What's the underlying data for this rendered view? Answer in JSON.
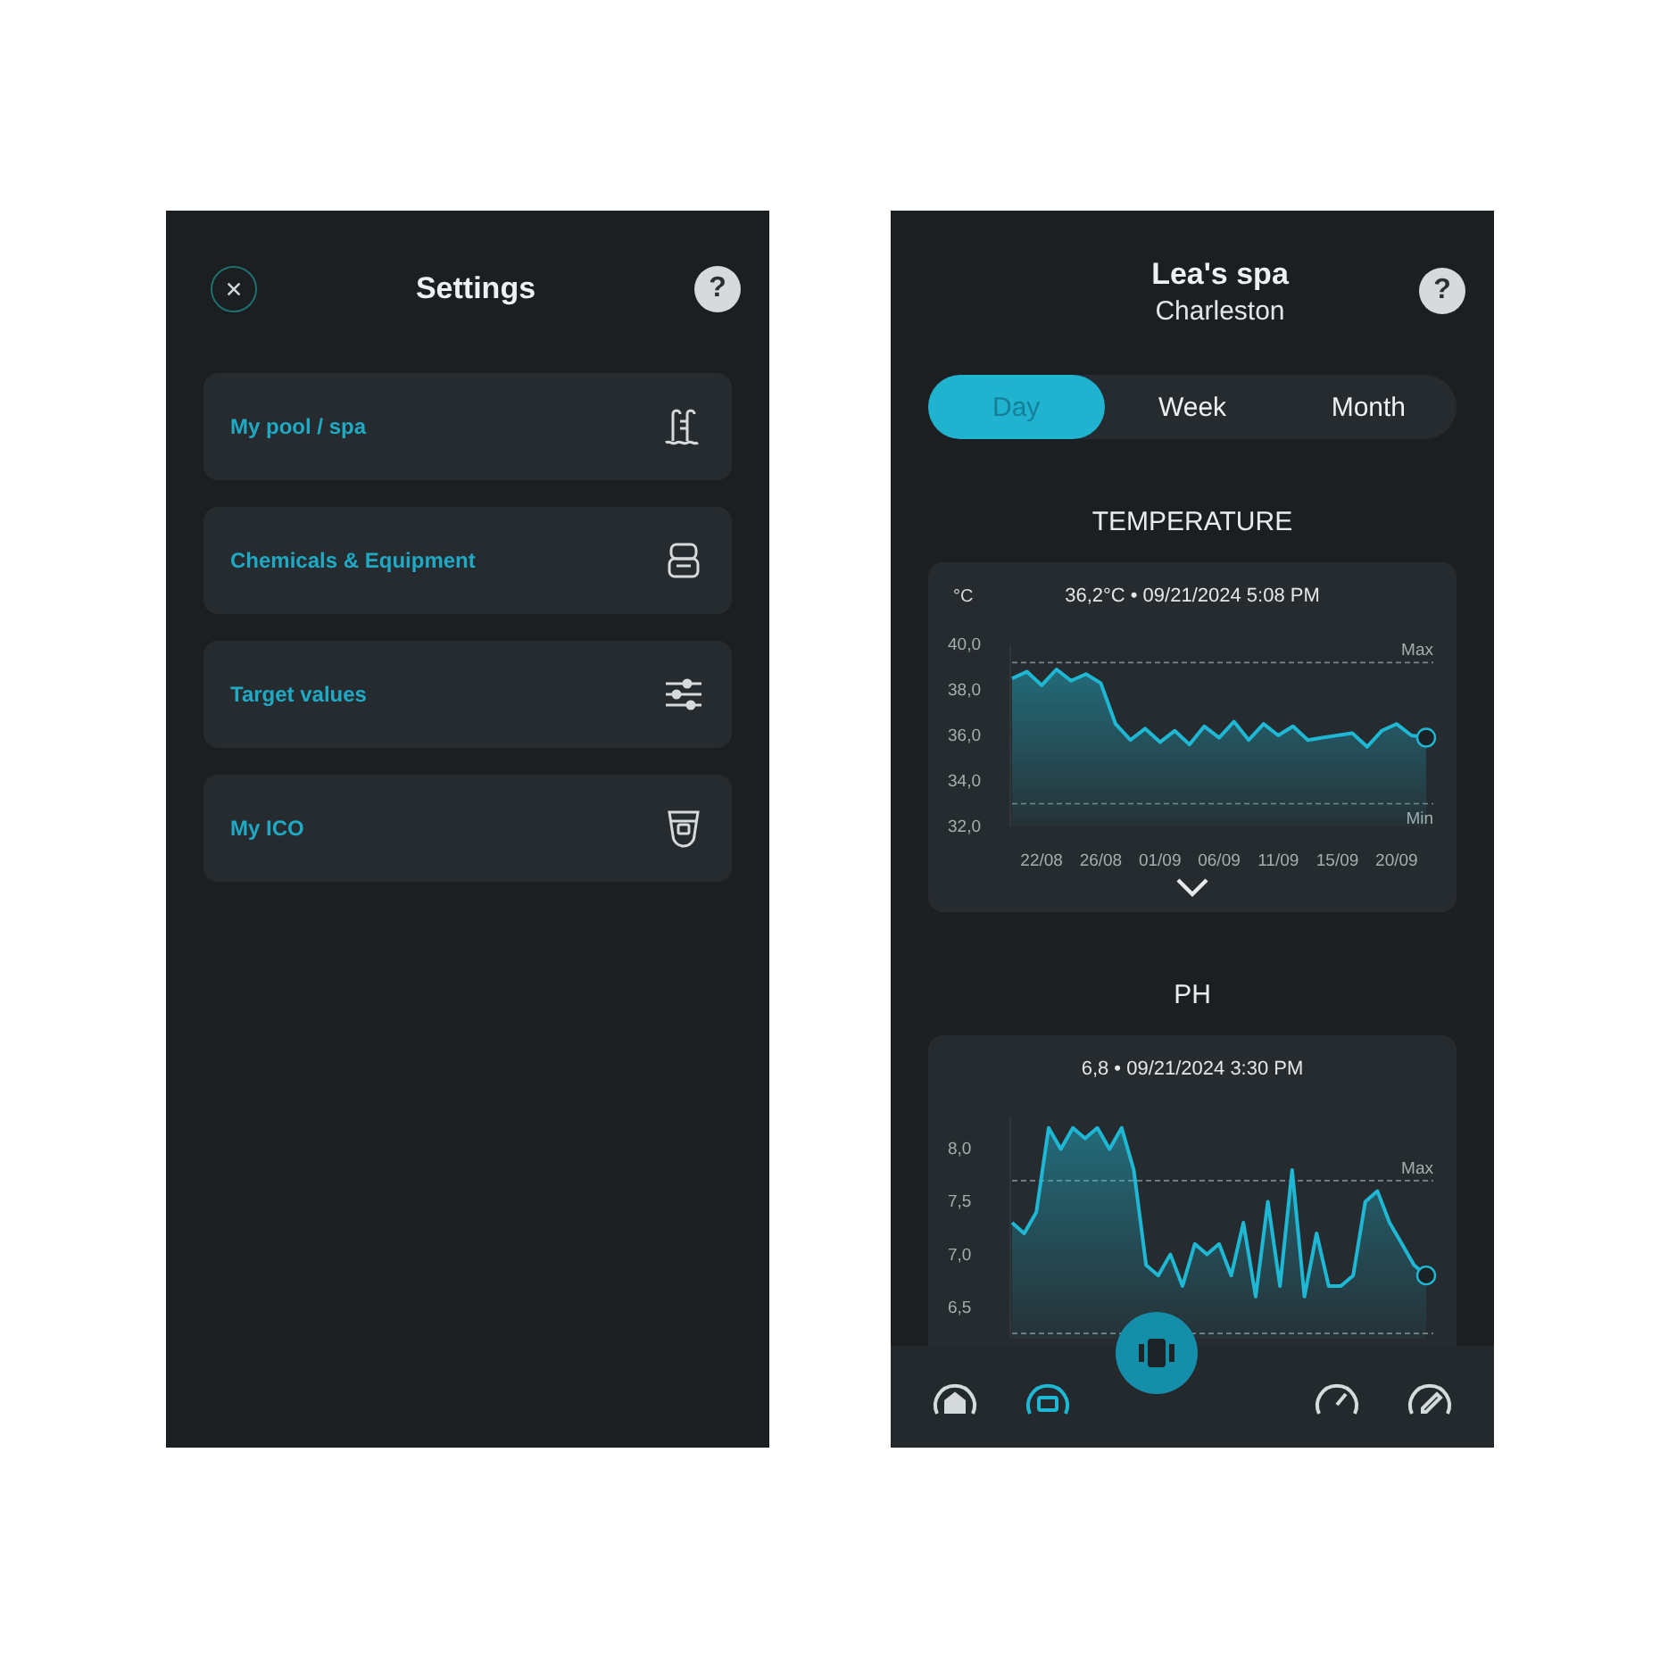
{
  "settings": {
    "title": "Settings",
    "help": "?",
    "items": [
      {
        "label": "My pool / spa",
        "kind": "pool"
      },
      {
        "label": "Chemicals & Equipment",
        "kind": "chemicals"
      },
      {
        "label": "Target values",
        "kind": "sliders"
      },
      {
        "label": "My ICO",
        "kind": "device"
      }
    ]
  },
  "history": {
    "title": "Lea's spa",
    "subtitle": "Charleston",
    "help": "?",
    "tabs": [
      {
        "label": "Day",
        "selected": true
      },
      {
        "label": "Week",
        "selected": false
      },
      {
        "label": "Month",
        "selected": false
      }
    ],
    "sections": [
      {
        "title": "TEMPERATURE",
        "reading": "36,2°C • 09/21/2024 5:08 PM",
        "expandable": true,
        "chart_data": {
          "type": "area",
          "ylabel": "°C",
          "ylim": [
            32,
            40
          ],
          "yticks": [
            {
              "value": 40,
              "label": "40,0"
            },
            {
              "value": 38,
              "label": "38,0"
            },
            {
              "value": 36,
              "label": "36,0"
            },
            {
              "value": 34,
              "label": "34,0"
            },
            {
              "value": 32,
              "label": "32,0"
            }
          ],
          "categories": [
            null,
            null,
            "22/08",
            null,
            null,
            null,
            "26/08",
            null,
            null,
            null,
            "01/09",
            null,
            null,
            null,
            "06/09",
            null,
            null,
            null,
            "11/09",
            null,
            null,
            null,
            "15/09",
            null,
            null,
            null,
            "20/09",
            null,
            null
          ],
          "series": [
            {
              "color": "#1fb8d4",
              "values": [
                38.5,
                38.8,
                38.2,
                38.9,
                38.4,
                38.7,
                38.3,
                36.5,
                35.8,
                36.3,
                35.7,
                36.2,
                35.6,
                36.4,
                35.9,
                36.6,
                35.8,
                36.5,
                36.0,
                36.4,
                35.8,
                35.9,
                36.0,
                36.1,
                35.5,
                36.2,
                36.5,
                36.0,
                35.9
              ]
            }
          ],
          "ref_lines": [
            {
              "axis": "y",
              "value": 39.2,
              "label": "Max"
            },
            {
              "axis": "y",
              "value": 33.0,
              "label": "Min"
            }
          ]
        }
      },
      {
        "title": "PH",
        "reading": "6,8 • 09/21/2024 3:30 PM",
        "expandable": false,
        "chart_data": {
          "type": "area",
          "ylim": [
            6.2,
            8.3
          ],
          "yticks": [
            {
              "value": 8.0,
              "label": "8,0"
            },
            {
              "value": 7.5,
              "label": "7,5"
            },
            {
              "value": 7.0,
              "label": "7,0"
            },
            {
              "value": 6.5,
              "label": "6,5"
            }
          ],
          "series": [
            {
              "color": "#1fb8d4",
              "values": [
                7.3,
                7.2,
                7.4,
                8.2,
                8.0,
                8.2,
                8.1,
                8.2,
                8.0,
                8.2,
                7.8,
                6.9,
                6.8,
                7.0,
                6.7,
                7.1,
                7.0,
                7.1,
                6.8,
                7.3,
                6.6,
                7.5,
                6.7,
                7.8,
                6.6,
                7.2,
                6.7,
                6.7,
                6.8,
                7.5,
                7.6,
                7.3,
                7.1,
                6.9,
                6.8
              ]
            }
          ],
          "ref_lines": [
            {
              "axis": "y",
              "value": 7.7,
              "label": "Max"
            },
            {
              "axis": "y",
              "value": 6.25
            }
          ]
        }
      }
    ]
  },
  "nav": [
    {
      "kind": "home",
      "selected": false
    },
    {
      "kind": "history",
      "selected": true
    },
    {
      "kind": "device",
      "selected": false
    },
    {
      "kind": "gauge",
      "selected": false
    },
    {
      "kind": "tools",
      "selected": false
    }
  ]
}
